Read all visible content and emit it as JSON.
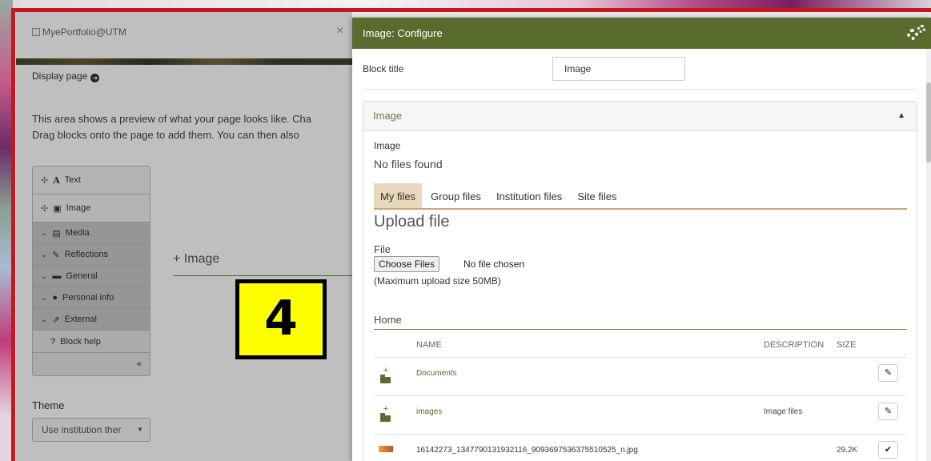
{
  "logo_alt": "MyePortfolio@UTM",
  "close_symbol": "×",
  "display_page": "Display page",
  "intro_lines": [
    "This area shows a preview of what your page looks like. Cha",
    "Drag blocks onto the page to add them. You can then also"
  ],
  "blocks": {
    "text": "Text",
    "image": "Image",
    "media": "Media",
    "reflections": "Reflections",
    "general": "General",
    "personal_info": "Personal info",
    "external": "External",
    "block_help": "Block help",
    "collapse": "«"
  },
  "placed_block": "+ Image",
  "annotation_number": "4",
  "theme": {
    "label": "Theme",
    "value": "Use institution ther"
  },
  "modal": {
    "title": "Image: Configure",
    "block_title_label": "Block title",
    "block_title_value": "Image",
    "panel_title": "Image",
    "image_label": "Image",
    "no_files": "No files found",
    "tabs": [
      "My files",
      "Group files",
      "Institution files",
      "Site files"
    ],
    "upload_title": "Upload file",
    "file_label": "File",
    "choose_files": "Choose Files",
    "no_file_chosen": "No file chosen",
    "max_upload": "(Maximum upload size 50MB)",
    "home": "Home",
    "columns": {
      "name": "NAME",
      "description": "DESCRIPTION",
      "size": "SIZE"
    },
    "rows": [
      {
        "name": "Documents",
        "description": "",
        "size": ""
      },
      {
        "name": "images",
        "description": "Image files",
        "size": ""
      },
      {
        "name": "16142273_1347790131932116_9093697536375510525_n.jpg",
        "description": "",
        "size": "29.2K"
      }
    ]
  },
  "colors": {
    "accent": "#5a6b2e",
    "frame": "#c8161d",
    "badge": "#ffff00"
  }
}
